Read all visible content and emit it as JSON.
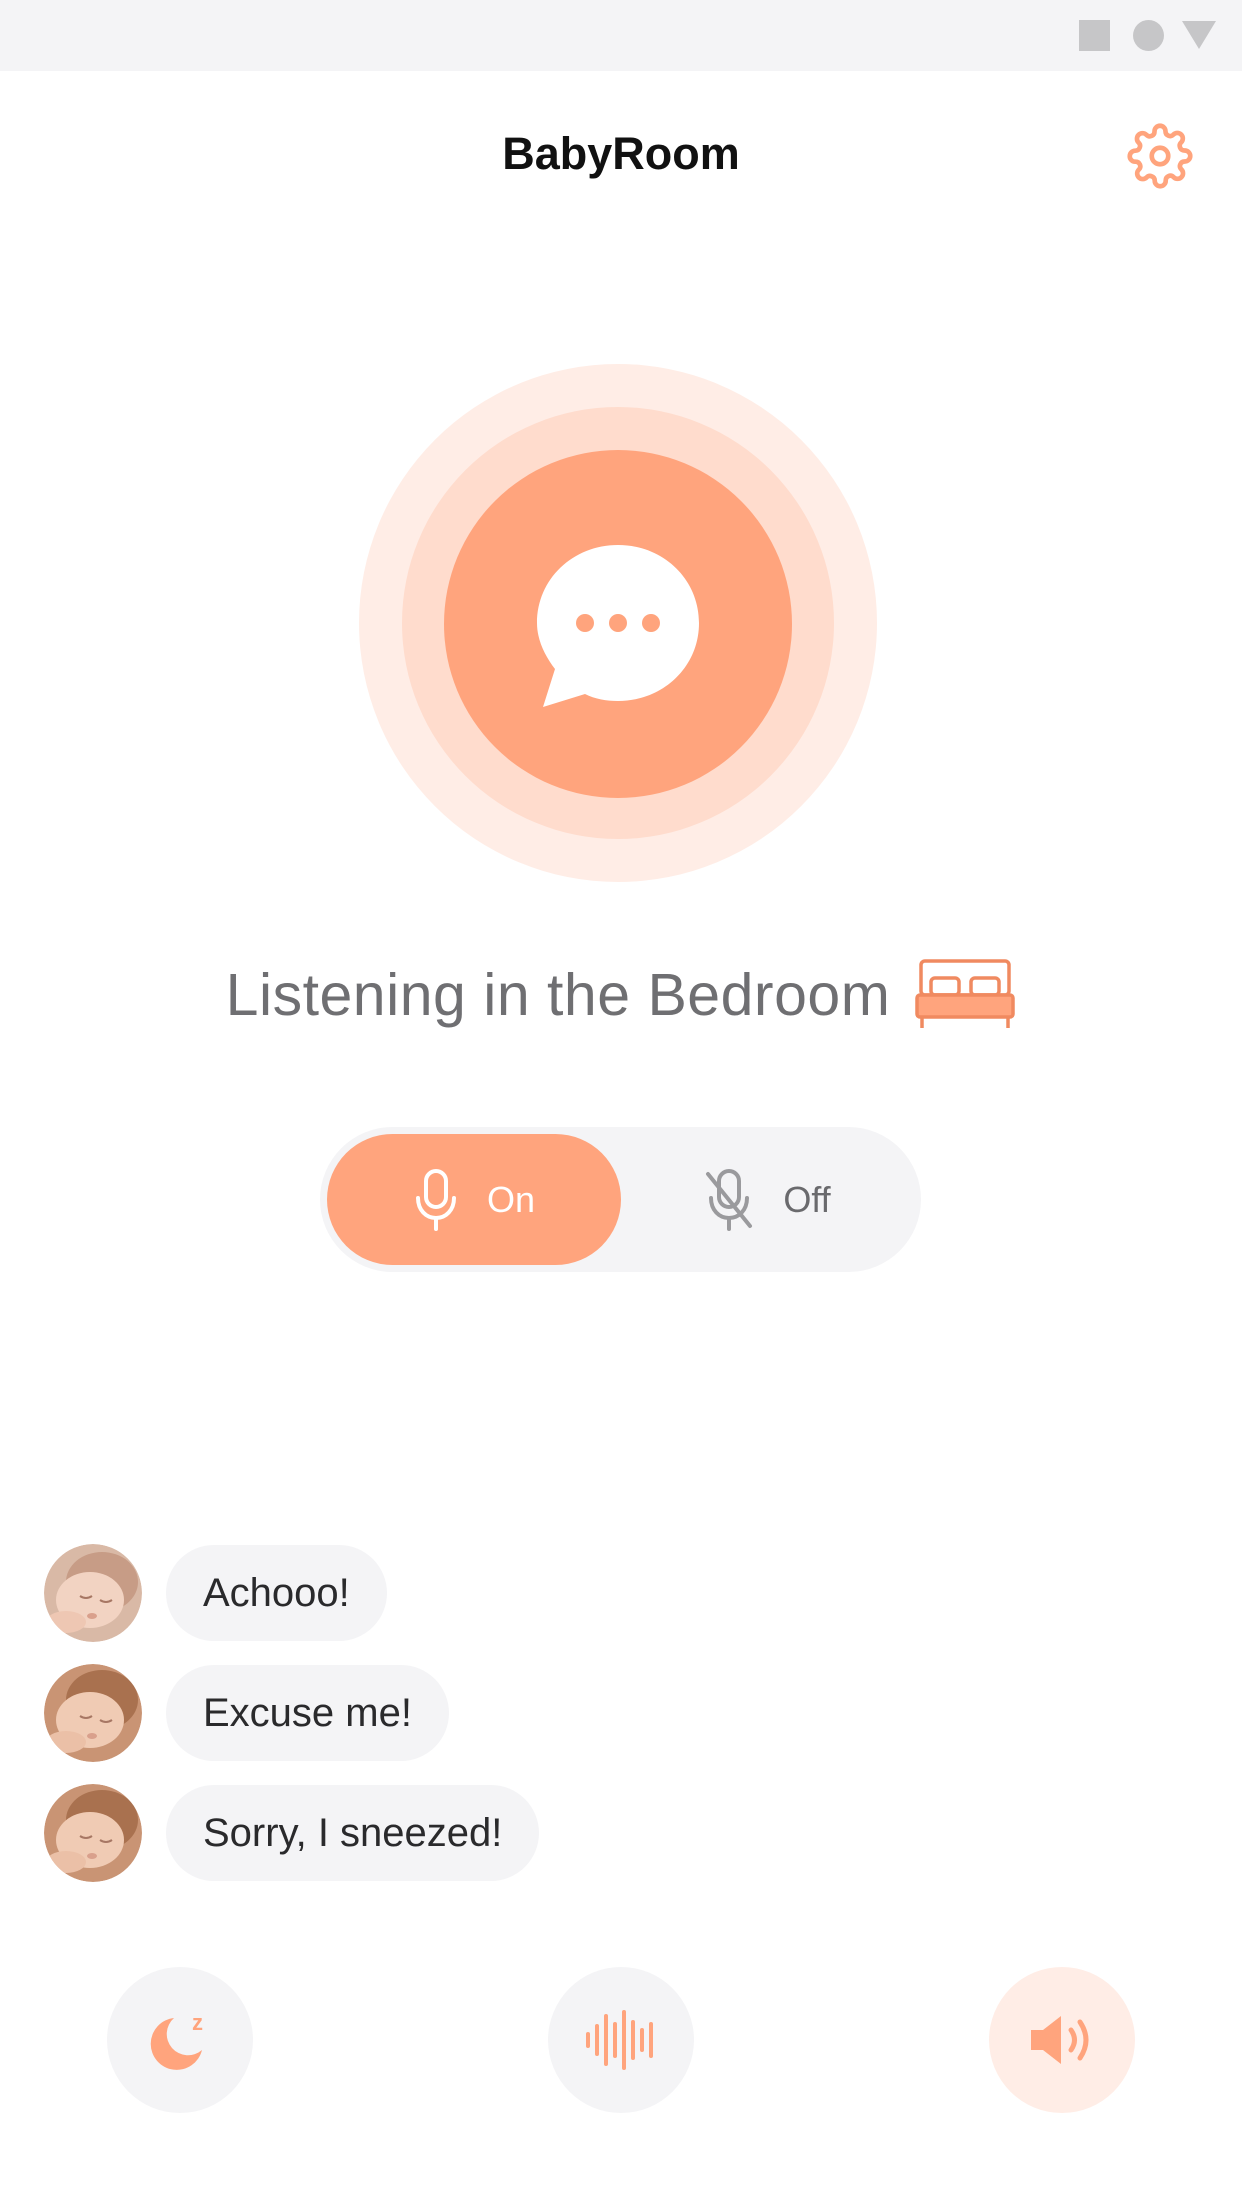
{
  "app": {
    "title": "BabyRoom",
    "accent_color": "#ffa47d"
  },
  "header": {
    "settings_icon": "gear-icon"
  },
  "monitor": {
    "center_icon": "chat-bubble-icon",
    "listening_text": "Listening in the Bedroom",
    "room_icon": "bed-icon"
  },
  "mic_toggle": {
    "on_label": "On",
    "off_label": "Off",
    "selected": "On",
    "on_icon": "microphone-icon",
    "off_icon": "microphone-off-icon"
  },
  "messages": [
    {
      "text": "Achooo!",
      "avatar": "baby-avatar"
    },
    {
      "text": "Excuse me!",
      "avatar": "baby-avatar"
    },
    {
      "text": "Sorry, I sneezed!",
      "avatar": "baby-avatar"
    }
  ],
  "actions": [
    {
      "icon": "sleep-moon-icon"
    },
    {
      "icon": "sound-wave-icon"
    },
    {
      "icon": "volume-icon"
    }
  ]
}
